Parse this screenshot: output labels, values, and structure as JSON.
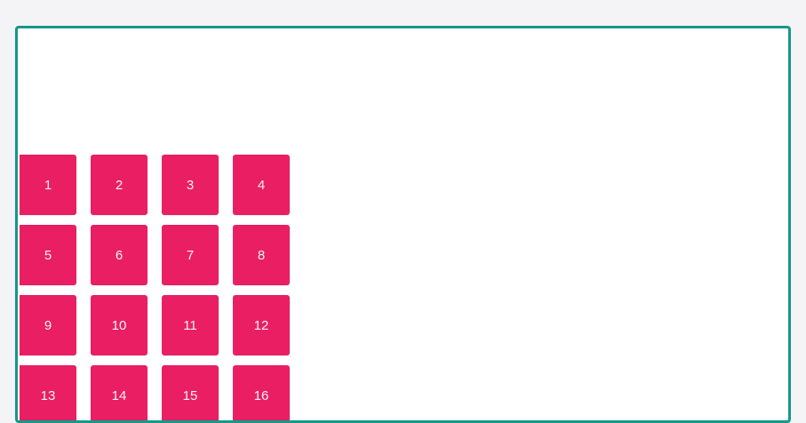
{
  "colors": {
    "page_background": "#f4f4f7",
    "frame_border": "#16988a",
    "tile_background": "#e91e63",
    "tile_text": "#fdf2f6"
  },
  "grid": {
    "items": [
      "1",
      "2",
      "3",
      "4",
      "5",
      "6",
      "7",
      "8",
      "9",
      "10",
      "11",
      "12",
      "13",
      "14",
      "15",
      "16"
    ]
  }
}
